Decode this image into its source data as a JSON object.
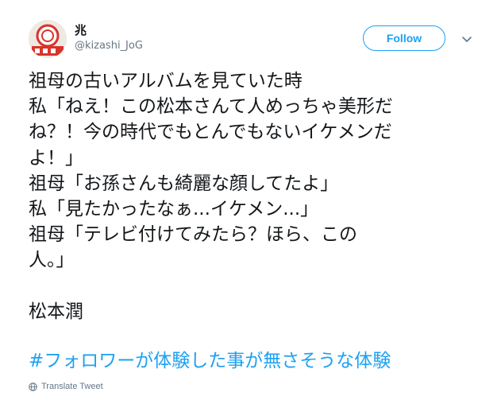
{
  "tweet": {
    "display_name": "兆",
    "handle": "@kizashi_JoG",
    "follow_label": "Follow",
    "text_lines": [
      "祖母の古いアルバムを見ていた時",
      "私「ねえ！この松本さんて人めっちゃ美形だ",
      "ね？！今の時代でもとんでもないイケメンだ",
      "よ！」",
      "祖母「お孫さんも綺麗な顔してたよ」",
      "私「見たかったなぁ...イケメン...」",
      "祖母「テレビ付けてみたら？ほら、この",
      "人。」",
      "",
      "松本潤"
    ],
    "hashtag": "#フォロワーが体験した事が無さそうな体験",
    "translate_label": "Translate Tweet"
  },
  "icons": {
    "caret": "chevron-down-icon",
    "translate": "globe-icon"
  },
  "colors": {
    "accent": "#1da1f2",
    "text": "#14171a",
    "secondary": "#657786"
  }
}
